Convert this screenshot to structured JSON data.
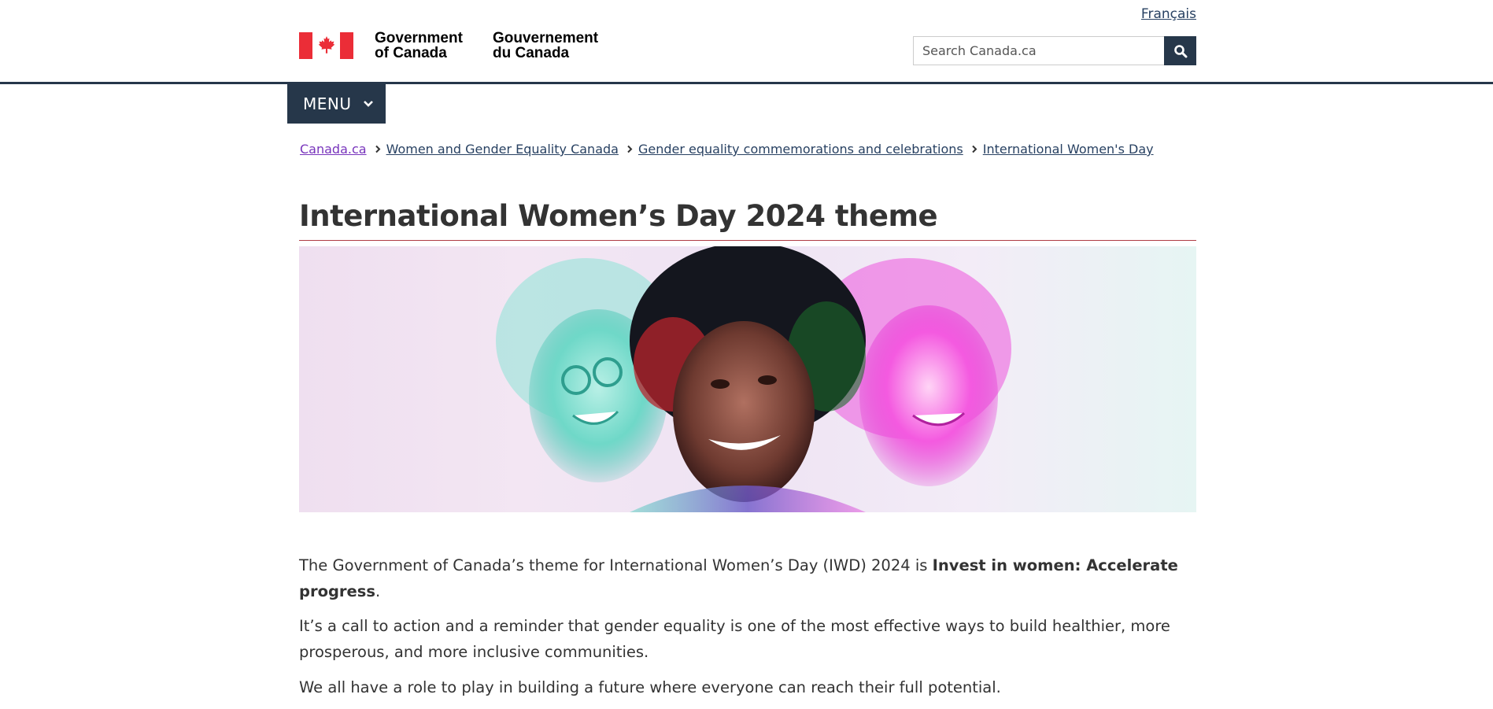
{
  "header": {
    "language_link": "Français",
    "signature_en_line1": "Government",
    "signature_en_line2": "of Canada",
    "signature_fr_line1": "Gouvernement",
    "signature_fr_line2": "du Canada",
    "search_placeholder": "Search Canada.ca",
    "colors": {
      "flag_red": "#eb2d37",
      "nav_dark": "#26374a"
    }
  },
  "menu": {
    "label": "MENU"
  },
  "breadcrumb": [
    "Canada.ca",
    "Women and Gender Equality Canada",
    "Gender equality commemorations and celebrations",
    "International Women's Day"
  ],
  "main": {
    "title": "International Women’s Day 2024 theme",
    "p1_text": "The Government of Canada’s theme for International Women’s Day (IWD) 2024 is ",
    "p1_bold": "Invest in women: Accelerate progress",
    "p1_end": ".",
    "p2": "It’s a call to action and a reminder that gender equality is one of the most effective ways to build healthier, more prosperous, and more inclusive communities.",
    "p3": "We all have a role to play in building a future where everyone can reach their full potential."
  }
}
